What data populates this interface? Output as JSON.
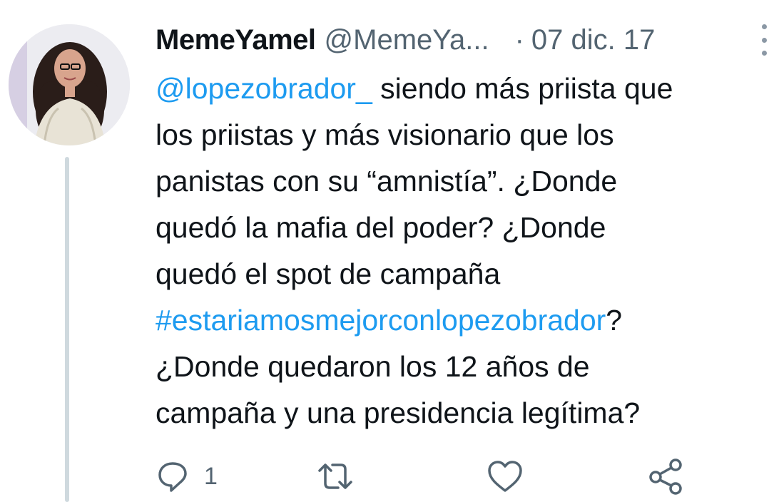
{
  "tweet": {
    "author": {
      "display_name": "MemeYamel",
      "handle": "@MemeYa...",
      "separator": "·",
      "date": "07 dic. 17"
    },
    "text_lines": [
      [
        {
          "text": "@lopezobrador_",
          "kind": "mention"
        },
        {
          "text": " siendo más priista que",
          "kind": "text"
        }
      ],
      [
        {
          "text": "los priistas y más visionario que los",
          "kind": "text"
        }
      ],
      [
        {
          "text": "panistas con su “amnistía”. ¿Donde",
          "kind": "text"
        }
      ],
      [
        {
          "text": "quedó la mafia del poder? ¿Donde",
          "kind": "text"
        }
      ],
      [
        {
          "text": "quedó el spot de campaña",
          "kind": "text"
        }
      ],
      [
        {
          "text": "#estariamosmejorconlopezobrador",
          "kind": "hashtag"
        },
        {
          "text": "?",
          "kind": "text"
        }
      ],
      [
        {
          "text": "¿Donde quedaron los 12 años de",
          "kind": "text"
        }
      ],
      [
        {
          "text": "campaña y una presidencia legítima?",
          "kind": "text"
        }
      ]
    ],
    "actions": {
      "reply_count": "1",
      "icons": [
        "reply-icon",
        "retweet-icon",
        "like-icon",
        "share-icon"
      ]
    },
    "colors": {
      "link": "#1d9bf0",
      "muted": "#536471",
      "thread_line": "#cfd9de"
    }
  }
}
